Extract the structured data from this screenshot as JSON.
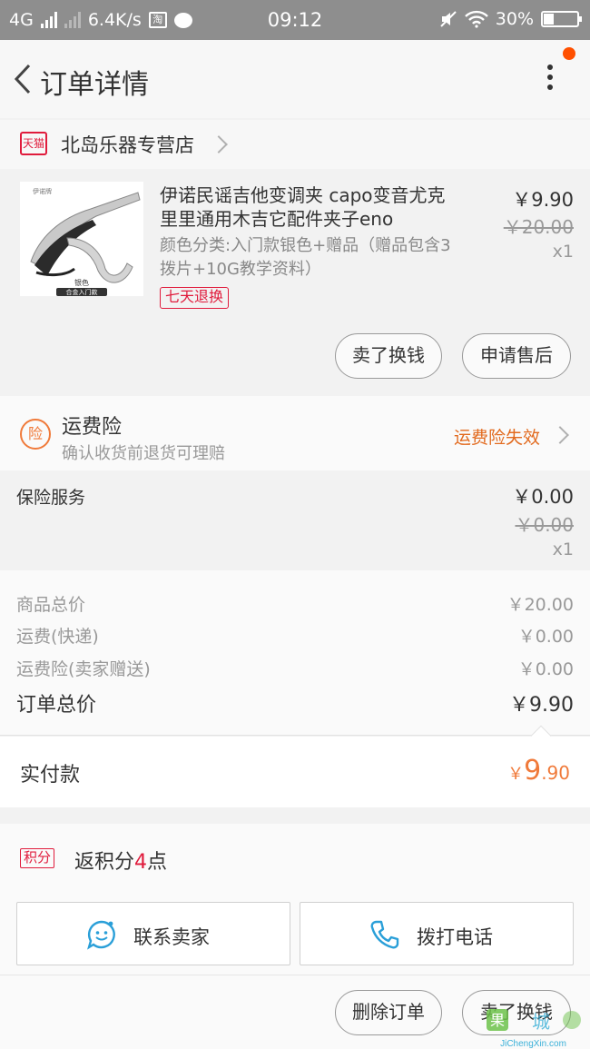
{
  "status_bar": {
    "network": "4G",
    "speed": "6.4K/s",
    "taobao_icon": "淘",
    "time": "09:12",
    "battery": "30%",
    "battery_level": 0.3
  },
  "header": {
    "title": "订单详情",
    "back_icon": "chevron-left",
    "more_icon": "vertical-ellipsis"
  },
  "shop": {
    "badge": "天猫",
    "name": "北岛乐器专营店"
  },
  "product": {
    "title": "伊诺民谣吉他变调夹 capo变音尤克里里通用木吉它配件夹子eno",
    "sku": "颜色分类:入门款银色+赠品（赠品包含3拨片+10G教学资料）",
    "image_caption_1": "银色",
    "image_caption_2": "合金入门款",
    "image_brand": "伊诺牌",
    "return_tag": "七天退换",
    "price": "￥9.90",
    "original_price": "￥20.00",
    "quantity": "x1",
    "buttons": {
      "sell": "卖了换钱",
      "after_sale": "申请售后"
    }
  },
  "freight_insurance": {
    "icon_label": "险",
    "title": "运费险",
    "subtitle": "确认收货前退货可理赔",
    "status": "运费险失效"
  },
  "insurance_service": {
    "label": "保险服务",
    "price": "￥0.00",
    "original_price": "￥0.00",
    "quantity": "x1"
  },
  "summary": {
    "goods_label": "商品总价",
    "goods_value": "￥20.00",
    "shipping_label": "运费(快递)",
    "shipping_value": "￥0.00",
    "insurance_label": "运费险(卖家赠送)",
    "insurance_value": "￥0.00",
    "total_label": "订单总价",
    "total_value": "￥9.90"
  },
  "payment": {
    "label": "实付款",
    "currency": "￥",
    "integer": "9",
    "decimal": ".90"
  },
  "points": {
    "badge": "积分",
    "prefix": "返积分",
    "value": "4",
    "suffix": "点"
  },
  "actions": {
    "contact_seller": "联系卖家",
    "call_phone": "拨打电话"
  },
  "bottom_buttons": {
    "delete": "删除订单",
    "sell": "卖了换钱"
  },
  "watermark": {
    "logo_char": "果",
    "cn_text": "城",
    "en_text": "JiChengXin.com"
  },
  "colors": {
    "accent_orange": "#f07a3a",
    "tmall_red": "#e01b3c",
    "status_bar": "#8e8e8e"
  }
}
